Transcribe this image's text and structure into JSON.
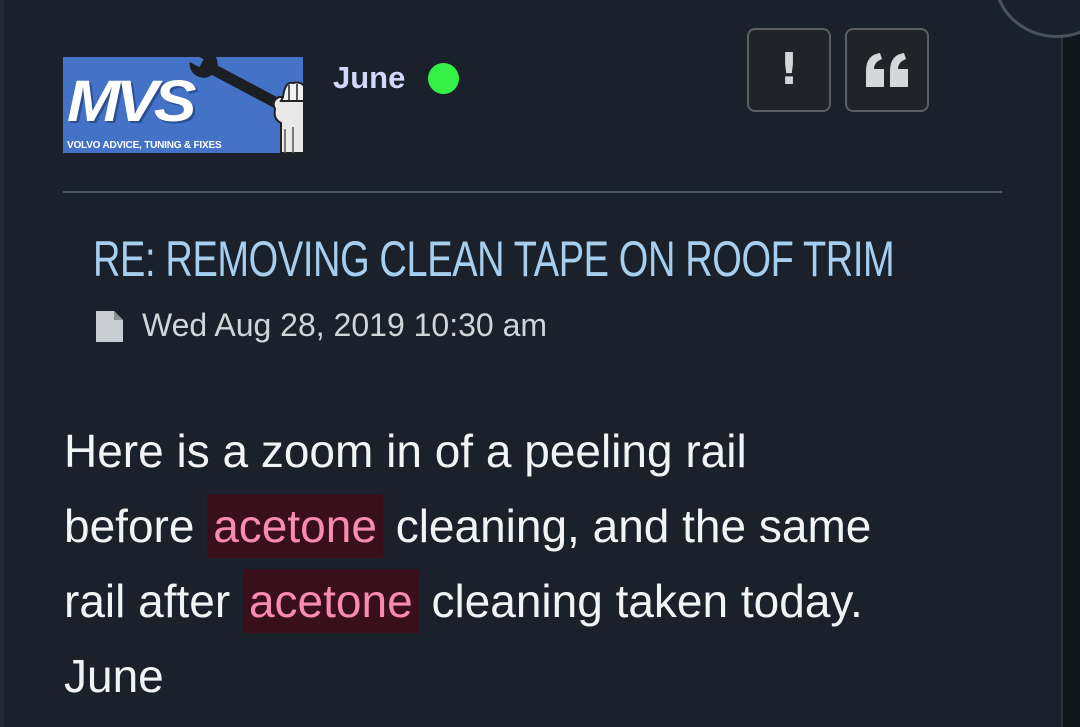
{
  "post": {
    "avatar": {
      "logo_text": "MVS",
      "tagline": "VOLVO ADVICE, TUNING & FIXES",
      "brand_color": "#4372c7"
    },
    "author": {
      "name": "June",
      "online_status_color": "#35f046"
    },
    "actions": {
      "report_glyph": "!",
      "report_icon": "exclamation-icon",
      "quote_icon": "quote-icon"
    },
    "title": "RE: REMOVING CLEAN TAPE ON ROOF TRIM",
    "meta": {
      "icon": "document-icon",
      "date": "Wed Aug 28, 2019 10:30 am"
    },
    "body": {
      "line1": "Here is a zoom in of a peeling rail",
      "line2_before": "before",
      "line2_highlight": "acetone",
      "line2_after": "cleaning, and the same",
      "line3_before": "rail after",
      "line3_highlight": "acetone",
      "line3_after": "cleaning taken today.",
      "signature": "June"
    },
    "colors": {
      "background": "#1a212a",
      "title": "#a6cfef",
      "username": "#d2d7fb",
      "highlight_bg": "#3a0f1c",
      "highlight_text": "#f98ab0"
    }
  }
}
